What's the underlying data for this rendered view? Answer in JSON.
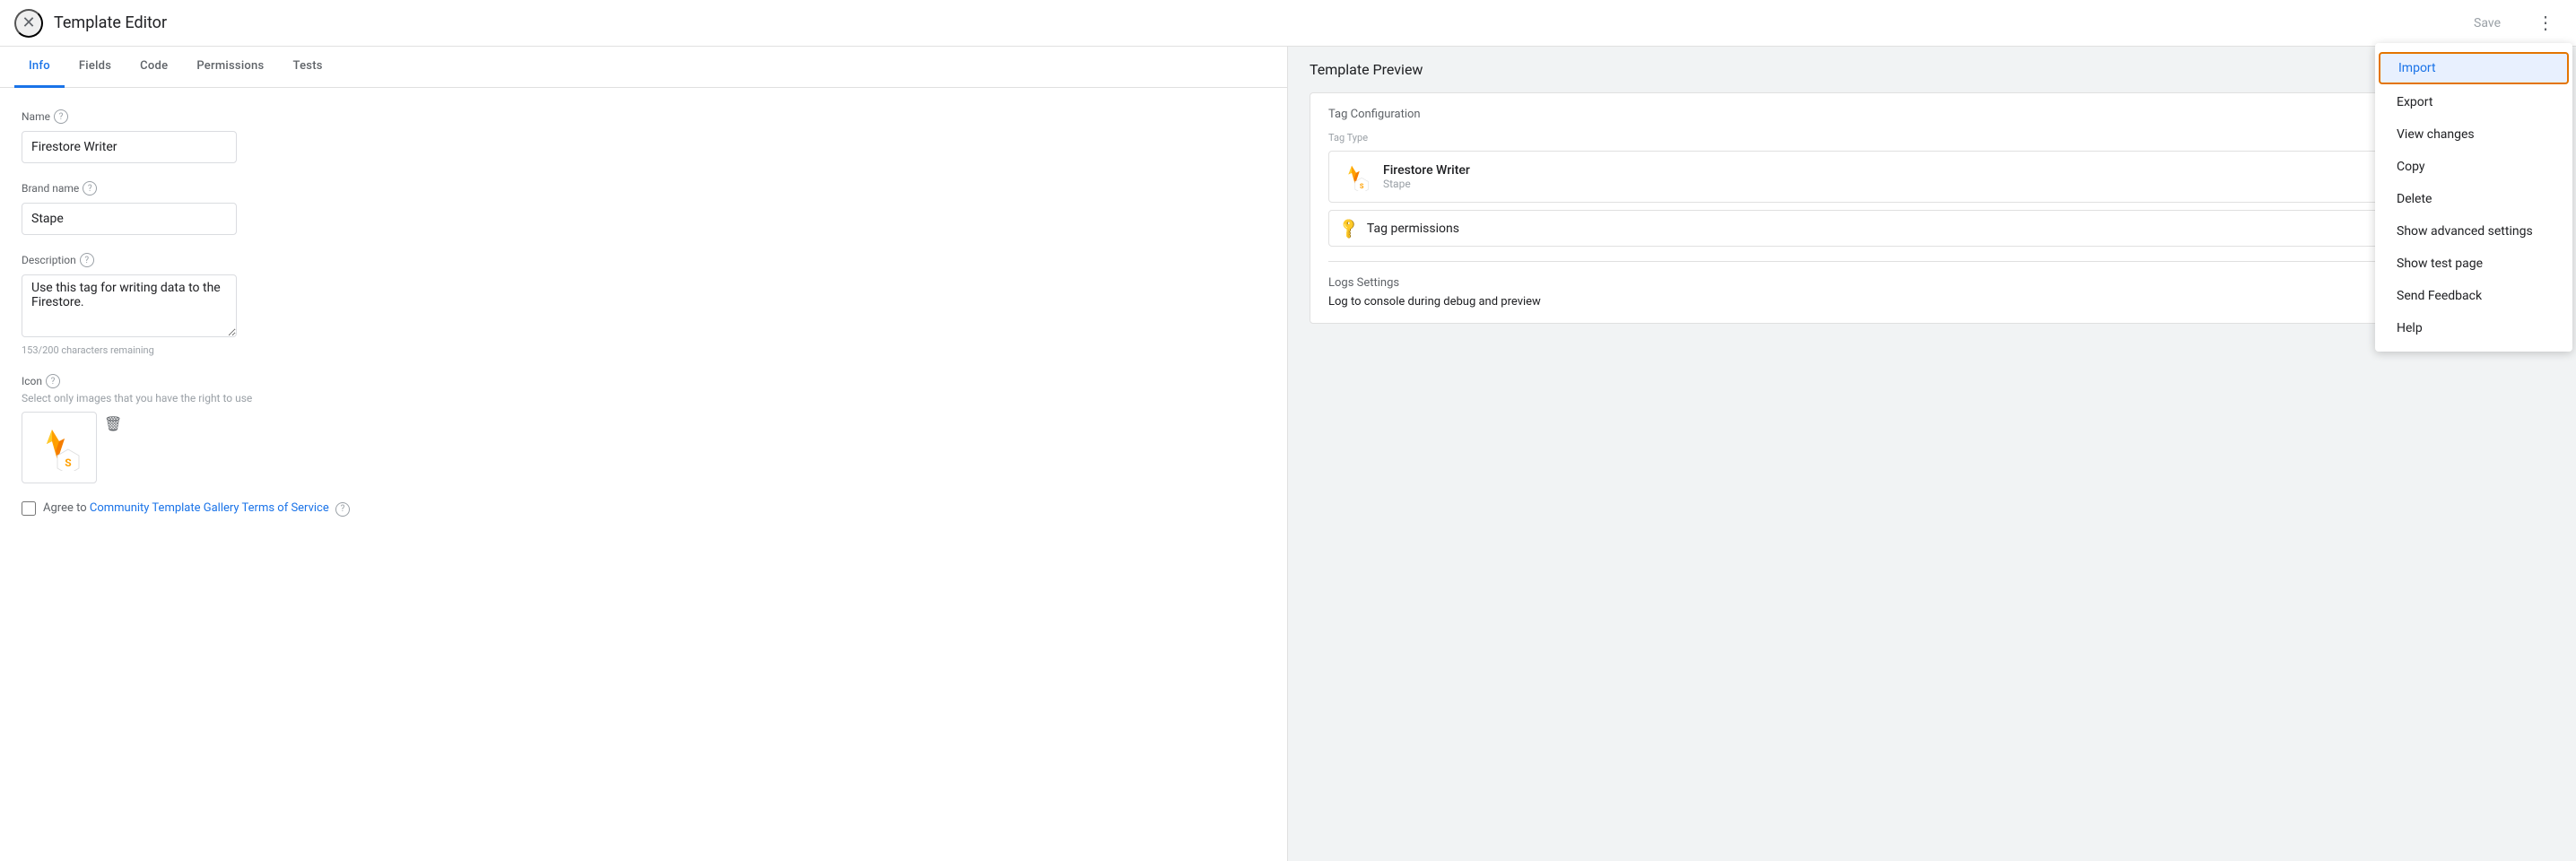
{
  "topbar": {
    "title": "Template Editor",
    "save_label": "Save"
  },
  "tabs": [
    {
      "label": "Info",
      "active": true
    },
    {
      "label": "Fields",
      "active": false
    },
    {
      "label": "Code",
      "active": false
    },
    {
      "label": "Permissions",
      "active": false
    },
    {
      "label": "Tests",
      "active": false
    }
  ],
  "form": {
    "name_label": "Name",
    "name_value": "Firestore Writer",
    "brand_label": "Brand name",
    "brand_value": "Stape",
    "description_label": "Description",
    "description_value": "Use this tag for writing data to the Firestore.",
    "char_count": "153/200 characters remaining",
    "icon_label": "Icon",
    "icon_instruction": "Select only images that you have the right to use",
    "checkbox_label": "Agree to",
    "checkbox_link": "Community Template Gallery Terms of Service"
  },
  "preview": {
    "title": "Template Preview",
    "tag_config_title": "Tag Configuration",
    "tag_type_label": "Tag Type",
    "tag_name": "Firestore Writer",
    "tag_brand": "Stape",
    "tag_permissions": "Tag permissions",
    "logs_title": "Logs Settings",
    "logs_value": "Log to console during debug and preview"
  },
  "dropdown": {
    "items": [
      {
        "label": "Import",
        "highlighted": true
      },
      {
        "label": "Export"
      },
      {
        "label": "View changes"
      },
      {
        "label": "Copy"
      },
      {
        "label": "Delete"
      },
      {
        "label": "Show advanced settings"
      },
      {
        "label": "Show test page"
      },
      {
        "label": "Send Feedback"
      },
      {
        "label": "Help"
      }
    ]
  },
  "colors": {
    "active_tab": "#1a73e8",
    "link": "#1a73e8",
    "import_highlight": "#e37400"
  }
}
